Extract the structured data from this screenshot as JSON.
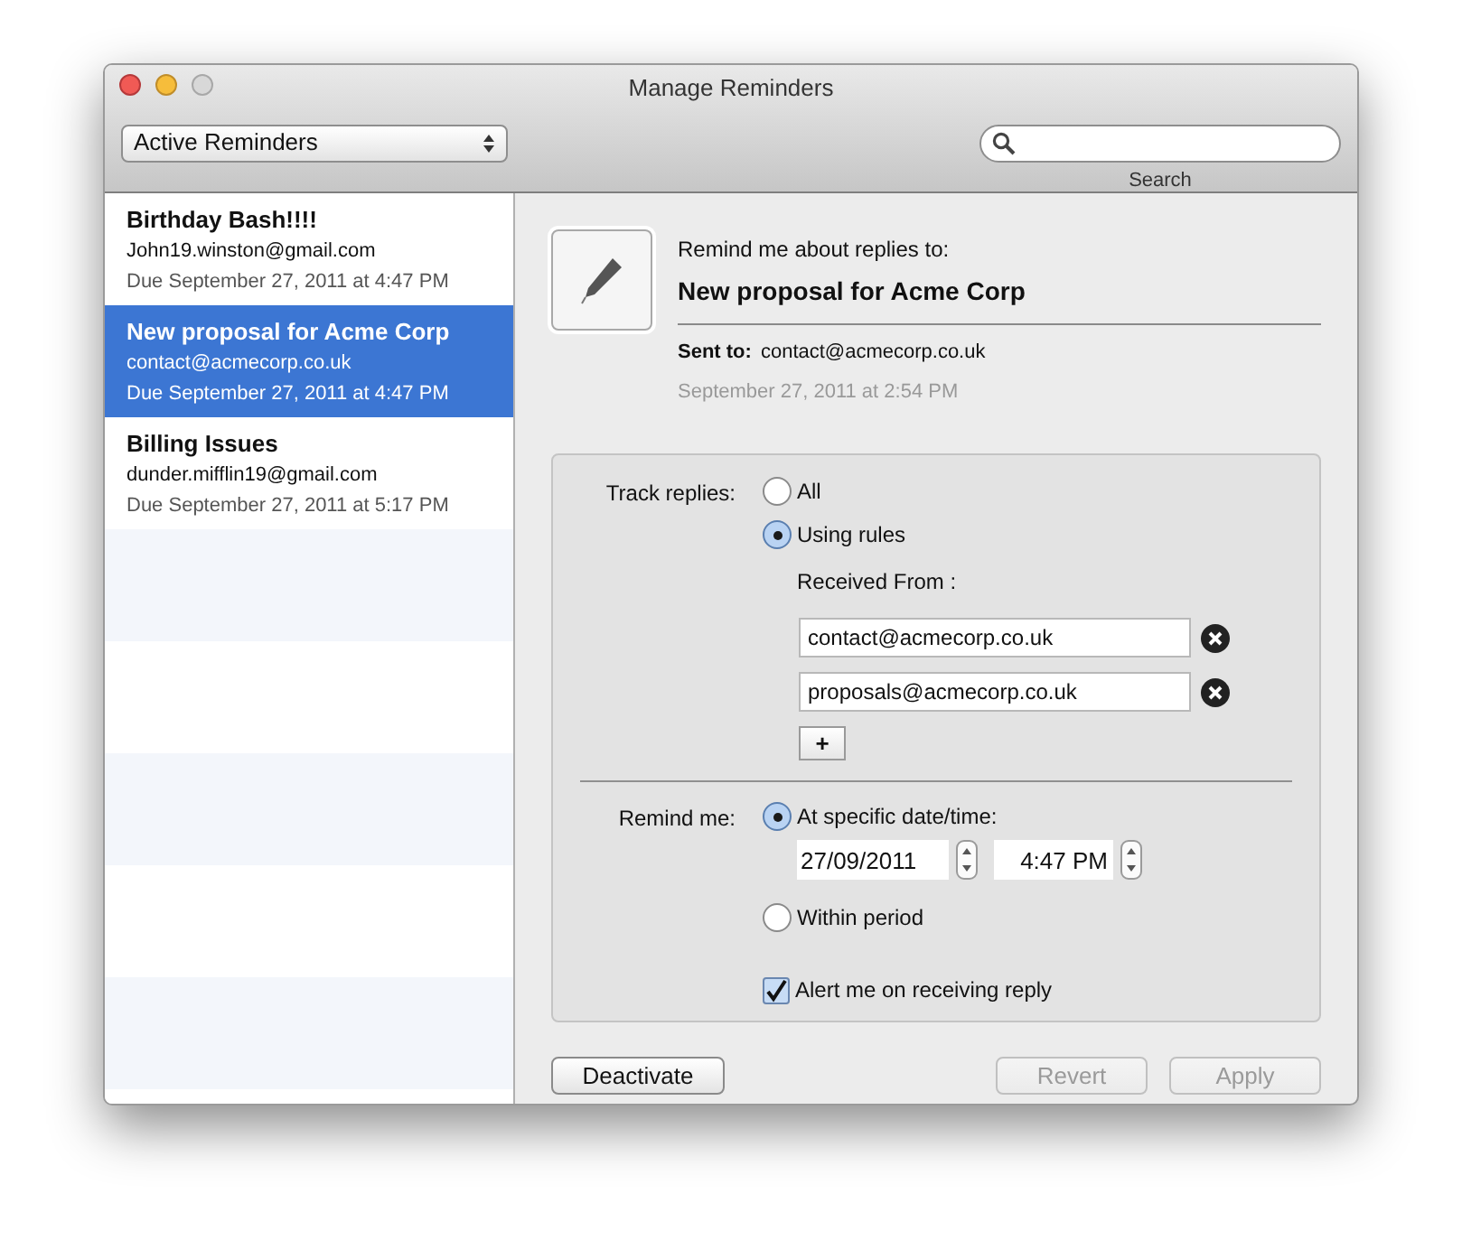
{
  "window": {
    "title": "Manage Reminders"
  },
  "toolbar": {
    "filter": "Active Reminders",
    "search_label": "Search"
  },
  "reminders": [
    {
      "title": "Birthday Bash!!!!",
      "email": "John19.winston@gmail.com",
      "due": "Due September 27, 2011 at 4:47 PM",
      "selected": false
    },
    {
      "title": "New proposal for Acme Corp",
      "email": "contact@acmecorp.co.uk",
      "due": "Due September 27, 2011 at 4:47 PM",
      "selected": true
    },
    {
      "title": "Billing Issues",
      "email": "dunder.mifflin19@gmail.com",
      "due": "Due September 27, 2011 at 5:17 PM",
      "selected": false
    }
  ],
  "detail": {
    "header_label": "Remind me about replies to:",
    "subject": "New proposal for Acme Corp",
    "sent_to_label": "Sent to:",
    "sent_to": "contact@acmecorp.co.uk",
    "sent_date": "September 27, 2011 at 2:54 PM"
  },
  "track_replies": {
    "label": "Track replies:",
    "options": [
      {
        "label": "All",
        "selected": false
      },
      {
        "label": "Using rules",
        "selected": true
      }
    ],
    "received_from_label": "Received From :",
    "addresses": [
      "contact@acmecorp.co.uk",
      "proposals@acmecorp.co.uk"
    ],
    "add_button": "+"
  },
  "remind_me": {
    "label": "Remind me:",
    "options": [
      {
        "label": "At specific date/time:",
        "selected": true,
        "date": "27/09/2011",
        "time": "4:47 PM"
      },
      {
        "label": "Within period",
        "selected": false
      }
    ]
  },
  "alert": {
    "label": "Alert me on receiving reply",
    "checked": true
  },
  "buttons": [
    {
      "label": "Deactivate",
      "disabled": false
    },
    {
      "label": "Revert",
      "disabled": true
    },
    {
      "label": "Apply",
      "disabled": true
    }
  ]
}
